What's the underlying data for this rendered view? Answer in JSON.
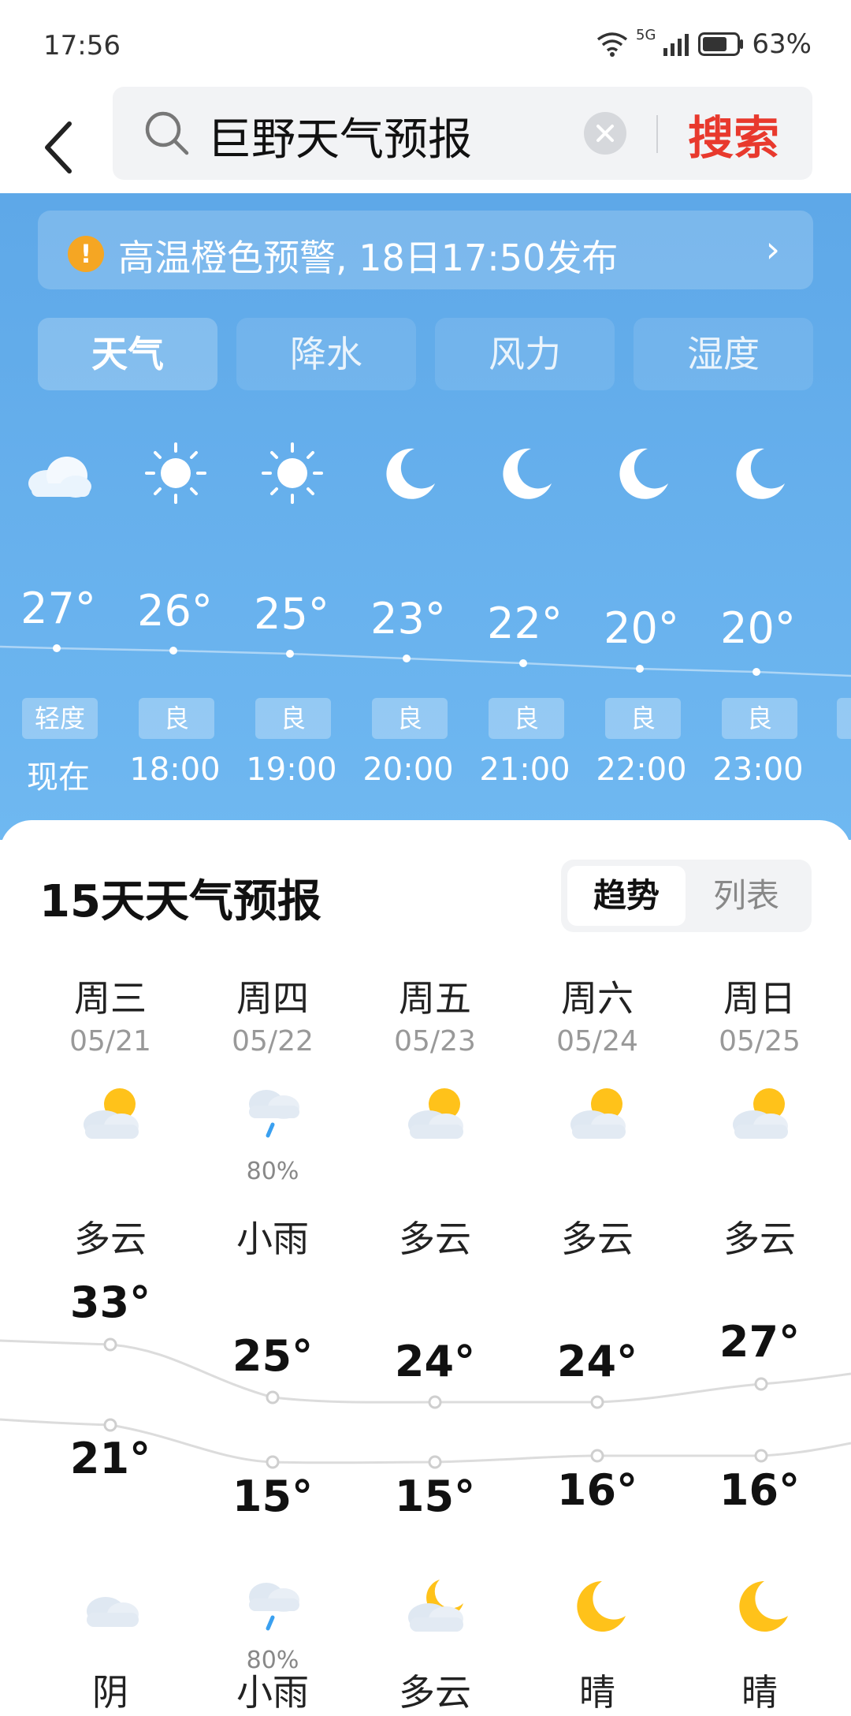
{
  "status_bar": {
    "time": "17:56",
    "network": "5G",
    "battery": "63%"
  },
  "search": {
    "query": "巨野天气预报",
    "button_label": "搜索"
  },
  "alert": {
    "text": "高温橙色预警, 18日17:50发布",
    "icon": "!"
  },
  "tabs": [
    {
      "label": "天气",
      "active": true
    },
    {
      "label": "降水",
      "active": false
    },
    {
      "label": "风力",
      "active": false
    },
    {
      "label": "湿度",
      "active": false
    }
  ],
  "hourly": [
    {
      "label": "现在",
      "temp": "27°",
      "aqi": "轻度",
      "icon": "cloudy-icon"
    },
    {
      "label": "18:00",
      "temp": "26°",
      "aqi": "良",
      "icon": "sun-icon"
    },
    {
      "label": "19:00",
      "temp": "25°",
      "aqi": "良",
      "icon": "sun-icon"
    },
    {
      "label": "20:00",
      "temp": "23°",
      "aqi": "良",
      "icon": "moon-icon"
    },
    {
      "label": "21:00",
      "temp": "22°",
      "aqi": "良",
      "icon": "moon-icon"
    },
    {
      "label": "22:00",
      "temp": "20°",
      "aqi": "良",
      "icon": "moon-icon"
    },
    {
      "label": "23:00",
      "temp": "20°",
      "aqi": "良",
      "icon": "moon-icon"
    }
  ],
  "forecast": {
    "title": "15天天气预报",
    "toggle": {
      "trend": "趋势",
      "list": "列表",
      "active": "trend"
    },
    "days": [
      {
        "weekday": "周三",
        "date": "05/21",
        "day_desc": "多云",
        "day_icon": "partly-cloudy-icon",
        "day_prob": "",
        "high": "33°",
        "low": "21°",
        "night_icon": "cloud-icon",
        "night_prob": "",
        "night_desc": "阴"
      },
      {
        "weekday": "周四",
        "date": "05/22",
        "day_desc": "小雨",
        "day_icon": "rain-icon",
        "day_prob": "80%",
        "high": "25°",
        "low": "15°",
        "night_icon": "rain-icon",
        "night_prob": "80%",
        "night_desc": "小雨"
      },
      {
        "weekday": "周五",
        "date": "05/23",
        "day_desc": "多云",
        "day_icon": "partly-cloudy-icon",
        "day_prob": "",
        "high": "24°",
        "low": "15°",
        "night_icon": "moon-cloud-icon",
        "night_prob": "",
        "night_desc": "多云"
      },
      {
        "weekday": "周六",
        "date": "05/24",
        "day_desc": "多云",
        "day_icon": "partly-cloudy-icon",
        "day_prob": "",
        "high": "24°",
        "low": "16°",
        "night_icon": "moon-icon",
        "night_prob": "",
        "night_desc": "晴"
      },
      {
        "weekday": "周日",
        "date": "05/25",
        "day_desc": "多云",
        "day_icon": "partly-cloudy-icon",
        "day_prob": "",
        "high": "27°",
        "low": "16°",
        "night_icon": "moon-icon",
        "night_prob": "",
        "night_desc": "晴"
      }
    ]
  },
  "colors": {
    "accent_red": "#e8392d",
    "sky_blue": "#6fb8f1",
    "alert_orange": "#f5a623"
  }
}
